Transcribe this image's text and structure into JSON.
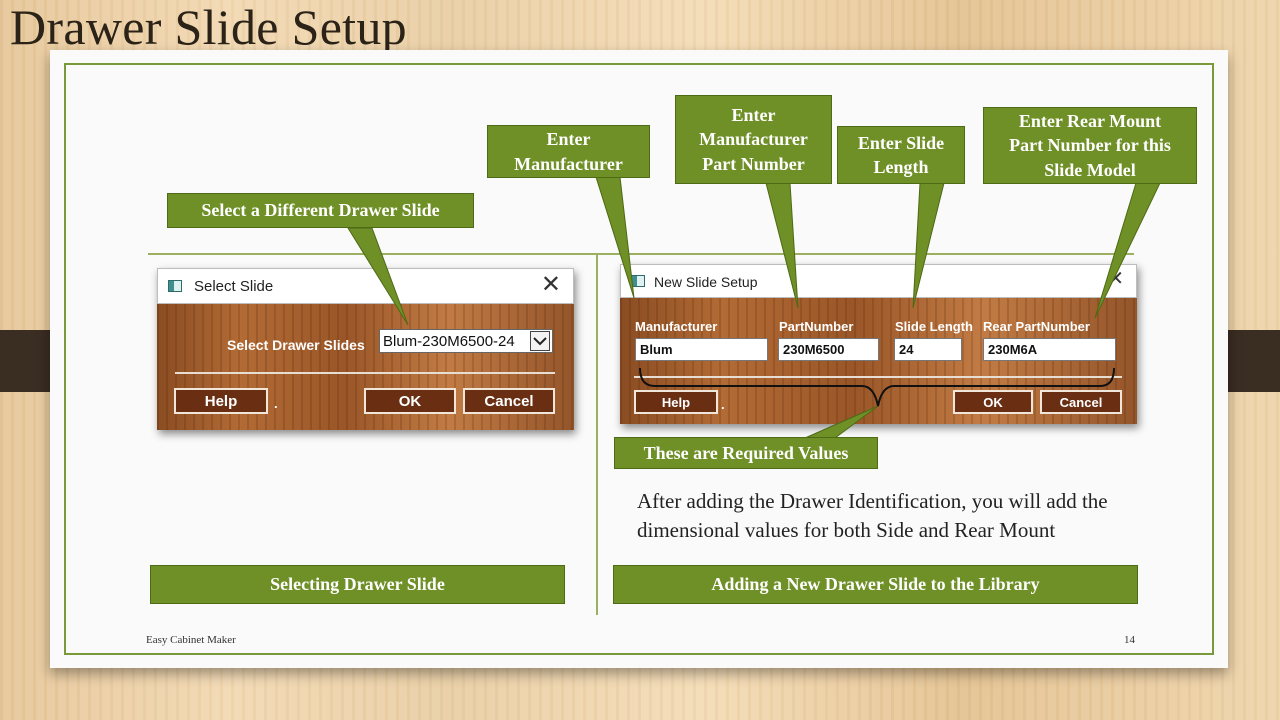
{
  "slide": {
    "title": "Drawer Slide Setup",
    "footer_left": "Easy Cabinet Maker",
    "page_number": "14",
    "body_text": "After adding the Drawer Identification, you will add the dimensional values for both Side and Rear Mount"
  },
  "colors": {
    "callout_green": "#6f8f27",
    "frame_green": "#7a9a3a",
    "button_brown": "#6a2f13",
    "strap_dark": "#3a2d22"
  },
  "callouts": {
    "select_different": "Select a Different Drawer Slide",
    "enter_manufacturer": "Enter\nManufacturer",
    "enter_part_number": "Enter\nManufacturer\nPart Number",
    "enter_slide_length": "Enter Slide\nLength",
    "enter_rear_mount": "Enter Rear Mount\nPart Number for this\nSlide Model",
    "required_values": "These are Required Values",
    "caption_left": "Selecting Drawer Slide",
    "caption_right": "Adding a New Drawer Slide to the Library"
  },
  "select_dialog": {
    "title": "Select Slide",
    "close_icon": "close-icon",
    "label": "Select Drawer Slides",
    "selected": "Blum-230M6500-24",
    "dropdown_icon": "chevron-down-icon",
    "help": "Help",
    "dot": ".",
    "ok": "OK",
    "cancel": "Cancel"
  },
  "new_dialog": {
    "title": "New Slide Setup",
    "close_icon": "close-icon",
    "labels": {
      "manufacturer": "Manufacturer",
      "part_number": "PartNumber",
      "slide_length": "Slide Length",
      "rear_part_number": "Rear PartNumber"
    },
    "values": {
      "manufacturer": "Blum",
      "part_number": "230M6500",
      "slide_length": "24",
      "rear_part_number": "230M6A"
    },
    "help": "Help",
    "dot": ".",
    "ok": "OK",
    "cancel": "Cancel"
  }
}
